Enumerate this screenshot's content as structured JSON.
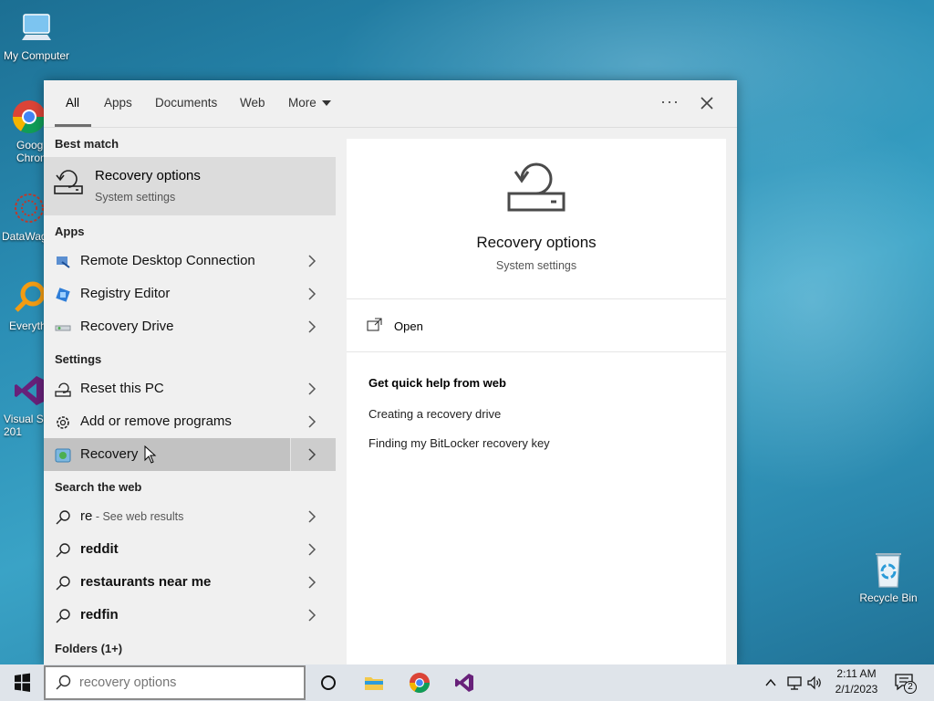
{
  "desktop": {
    "icons": [
      {
        "label": "My Computer"
      },
      {
        "label": "Goog Chron"
      },
      {
        "label": "DataWag"
      },
      {
        "label": "Everyth"
      },
      {
        "label": "Visual St 201"
      },
      {
        "label": "Recycle Bin"
      }
    ]
  },
  "search_panel": {
    "tabs": [
      "All",
      "Apps",
      "Documents",
      "Web",
      "More"
    ],
    "active_tab": "All",
    "best_match_header": "Best match",
    "best_match": {
      "title": "Recovery options",
      "subtitle": "System settings"
    },
    "apps_header": "Apps",
    "apps": [
      {
        "label": "Remote Desktop Connection",
        "icon": "remote-desktop-icon"
      },
      {
        "label": "Registry Editor",
        "icon": "registry-editor-icon"
      },
      {
        "label": "Recovery Drive",
        "icon": "recovery-drive-icon"
      }
    ],
    "settings_header": "Settings",
    "settings": [
      {
        "label": "Reset this PC",
        "icon": "reset-pc-icon"
      },
      {
        "label": "Add or remove programs",
        "icon": "gear-icon"
      },
      {
        "label": "Recovery",
        "icon": "recovery-icon"
      }
    ],
    "web_header": "Search the web",
    "web": [
      {
        "label": "re",
        "sub": " - See web results"
      },
      {
        "label": "reddit"
      },
      {
        "label": "restaurants near me"
      },
      {
        "label": "redfin"
      }
    ],
    "folders_header": "Folders (1+)",
    "detail": {
      "title": "Recovery options",
      "subtitle": "System settings",
      "open_label": "Open",
      "quick_help_header": "Get quick help from web",
      "links": [
        "Creating a recovery drive",
        "Finding my BitLocker recovery key"
      ]
    }
  },
  "taskbar": {
    "search_value": "recovery options",
    "clock_time": "2:11 AM",
    "clock_date": "2/1/2023",
    "notification_count": "2"
  },
  "colors": {
    "accent_vs": "#68217a",
    "selection": "#c2c2c2",
    "best_match_bg": "#dcdcdc"
  }
}
